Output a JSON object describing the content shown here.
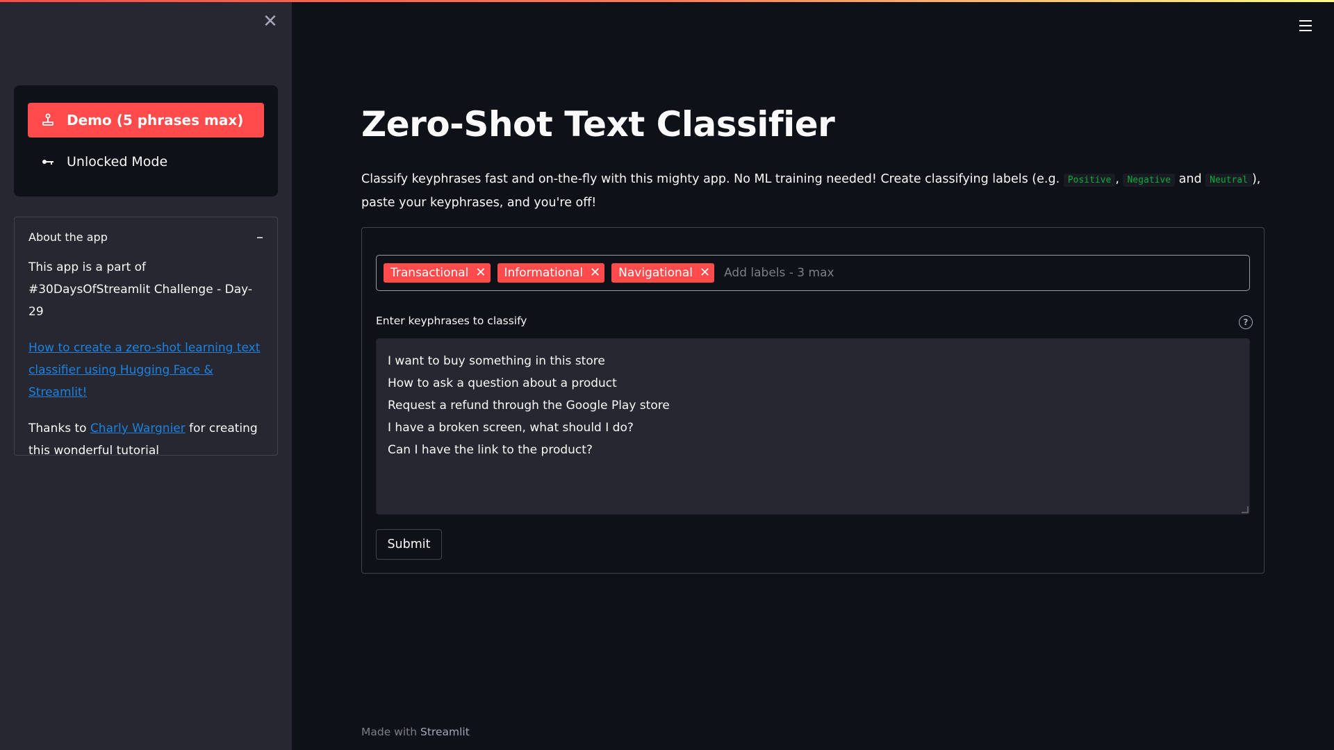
{
  "sidebar": {
    "close_label": "✕",
    "modes": {
      "demo_label": "Demo (5 phrases max)",
      "demo_icon": "joystick-icon",
      "unlocked_label": "Unlocked Mode",
      "unlocked_icon": "key-icon"
    },
    "about": {
      "title": "About the app",
      "collapse_symbol": "–",
      "text1": "This app is a part of #30DaysOfStreamlit Challenge - Day-29",
      "link_text": "How to create a zero-shot learning text classifier using Hugging Face & Streamlit!",
      "thanks_prefix": "Thanks to ",
      "thanks_link": "Charly Wargnier",
      "thanks_suffix": " for creating this wonderful tutorial"
    }
  },
  "header": {
    "menu_icon": "hamburger-menu-icon"
  },
  "main": {
    "title": "Zero-Shot Text Classifier",
    "intro": {
      "part1": "Classify keyphrases fast and on-the-fly with this mighty app. No ML training needed! Create classifying labels (e.g. ",
      "code1": "Positive",
      "sep1": ", ",
      "code2": "Negative",
      "sep2": " and ",
      "code3": "Neutral",
      "part2": "), paste your keyphrases, and you're off!"
    },
    "form": {
      "labels": [
        "Transactional",
        "Informational",
        "Navigational"
      ],
      "labels_placeholder": "Add labels - 3 max",
      "textarea_label": "Enter keyphrases to classify",
      "help_symbol": "?",
      "textarea_value": "I want to buy something in this store\nHow to ask a question about a product\nRequest a refund through the Google Play store\nI have a broken screen, what should I do?\nCan I have the link to the product?",
      "submit_label": "Submit"
    },
    "footer": {
      "prefix": "Made with ",
      "brand": "Streamlit"
    }
  },
  "colors": {
    "accent": "#ff4b4b",
    "background": "#0e1117",
    "sidebar": "#262730",
    "link": "#1c83e1",
    "code": "#09ab3b"
  }
}
